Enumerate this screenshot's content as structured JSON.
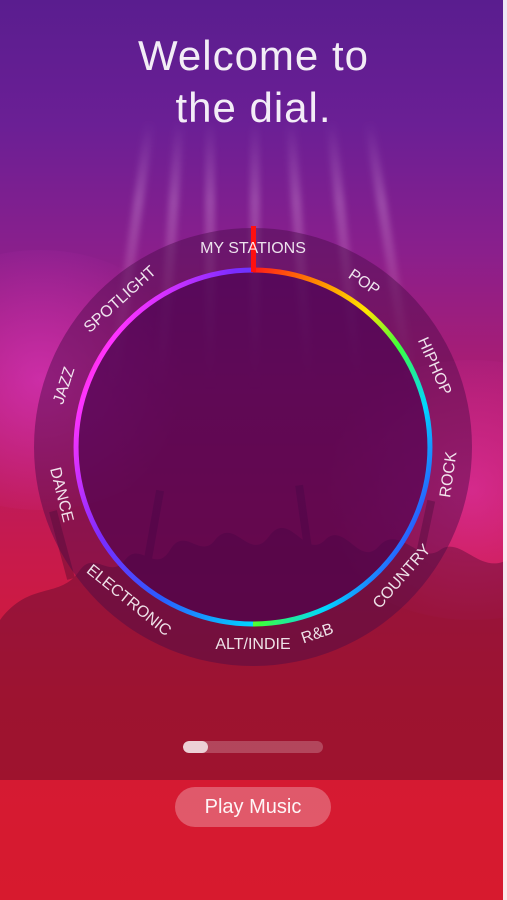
{
  "title": {
    "line1": "Welcome to",
    "line2": "the dial."
  },
  "dial": {
    "stations": [
      "MY STATIONS",
      "POP",
      "HIPHOP",
      "ROCK",
      "COUNTRY",
      "R&B",
      "ALT/INDIE",
      "ELECTRONIC",
      "DANCE",
      "JAZZ",
      "SPOTLIGHT"
    ],
    "selected_station": "MY STATIONS",
    "ring_colors": [
      "#ff1a1a",
      "#ff8a00",
      "#ffe600",
      "#3cff3c",
      "#00d6ff",
      "#2a5cff",
      "#7a2cff",
      "#ff33ff"
    ]
  },
  "progress": {
    "fraction": 0.18
  },
  "buttons": {
    "play_label": "Play Music"
  }
}
